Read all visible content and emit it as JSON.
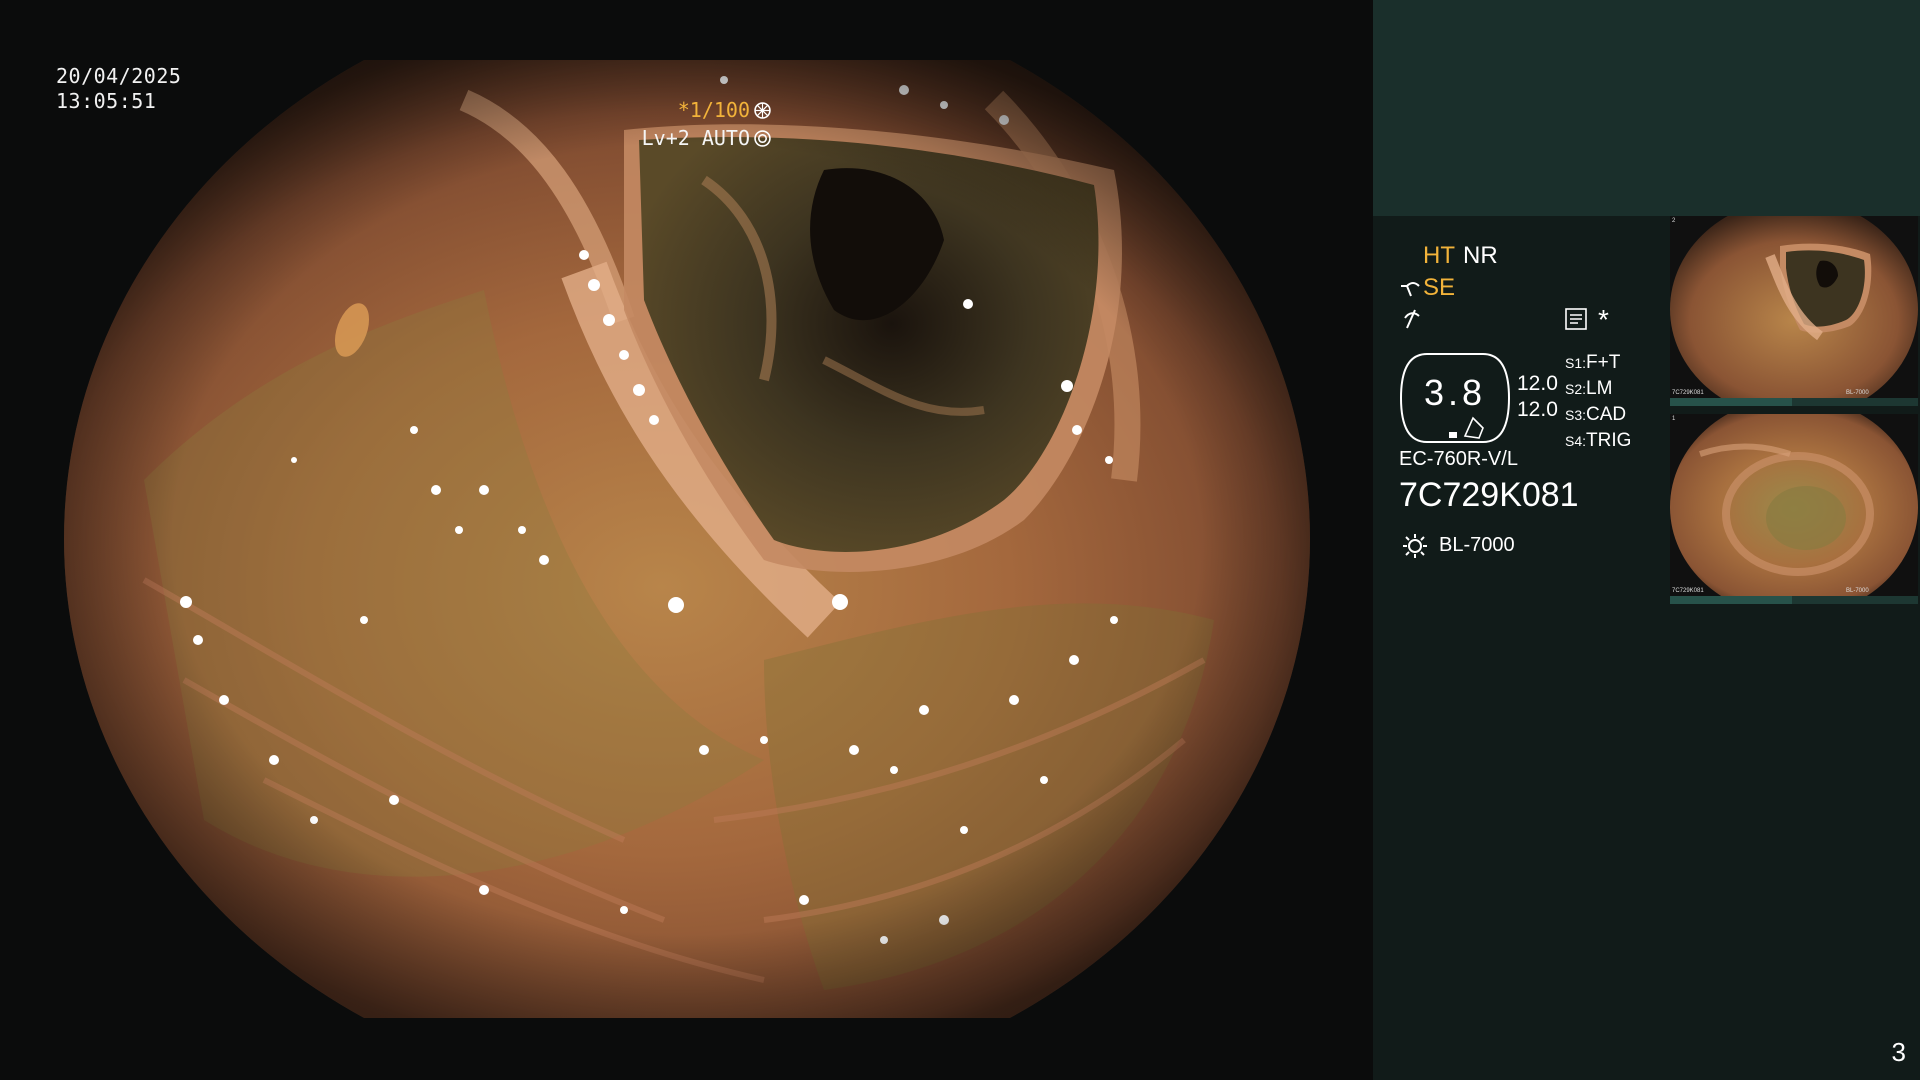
{
  "overlay": {
    "date": "20/04/2025",
    "time": "13:05:51",
    "shutter": "*1/100",
    "level": "Lv+2",
    "iris_mode": "AUTO"
  },
  "status": {
    "ht": "HT",
    "nr": "NR",
    "se": "SE",
    "star": "*",
    "zoom_value": "3.8",
    "val_a": "12.0",
    "val_b": "12.0",
    "scope_model": "EC-760R-V/L",
    "serial": "7C729K081",
    "light_source": "BL-7000",
    "switches": [
      {
        "key": "S1:",
        "value": "F+T"
      },
      {
        "key": "S2:",
        "value": "LM"
      },
      {
        "key": "S3:",
        "value": "CAD"
      },
      {
        "key": "S4:",
        "value": "TRIG"
      }
    ]
  },
  "thumbnails": [
    {
      "index": "2",
      "serial": "7C729K081",
      "light": "BL-7000"
    },
    {
      "index": "1",
      "serial": "7C729K081",
      "light": "BL-7000"
    }
  ],
  "page_number": "3",
  "colors": {
    "right_panel": "#111b19",
    "right_top": "#1a2f2b",
    "accent_yellow": "#f2b33a"
  },
  "icons": [
    "shutter-icon",
    "iris-icon",
    "enhance-icon",
    "contrast-icon",
    "menu-icon",
    "zoom-frame-icon",
    "light-source-icon"
  ]
}
